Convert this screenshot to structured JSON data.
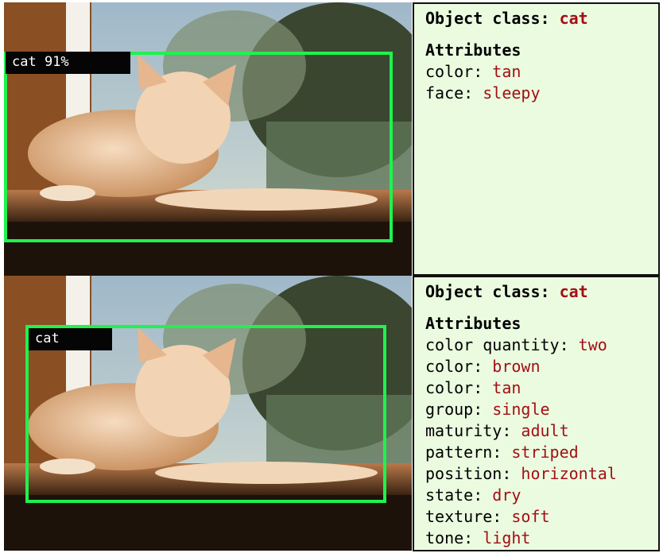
{
  "top": {
    "detection_label": "cat 91%",
    "class_label": "Object class: ",
    "class_value": "cat",
    "attributes_heading": "Attributes",
    "attributes": [
      {
        "key": "color: ",
        "value": "tan"
      },
      {
        "key": "face: ",
        "value": "sleepy"
      }
    ]
  },
  "bottom": {
    "detection_label": "cat",
    "class_label": "Object class: ",
    "class_value": "cat",
    "attributes_heading": "Attributes",
    "attributes": [
      {
        "key": "color quantity: ",
        "value": "two"
      },
      {
        "key": "color: ",
        "value": "brown"
      },
      {
        "key": "color: ",
        "value": "tan"
      },
      {
        "key": "group: ",
        "value": "single"
      },
      {
        "key": "maturity: ",
        "value": "adult"
      },
      {
        "key": "pattern: ",
        "value": "striped"
      },
      {
        "key": "position: ",
        "value": "horizontal"
      },
      {
        "key": "state: ",
        "value": "dry"
      },
      {
        "key": "texture: ",
        "value": "soft"
      },
      {
        "key": "tone: ",
        "value": "light"
      }
    ]
  },
  "colors": {
    "box": "#1ff24e",
    "panel_bg": "#eafbe0",
    "value_text": "#a30f14"
  }
}
